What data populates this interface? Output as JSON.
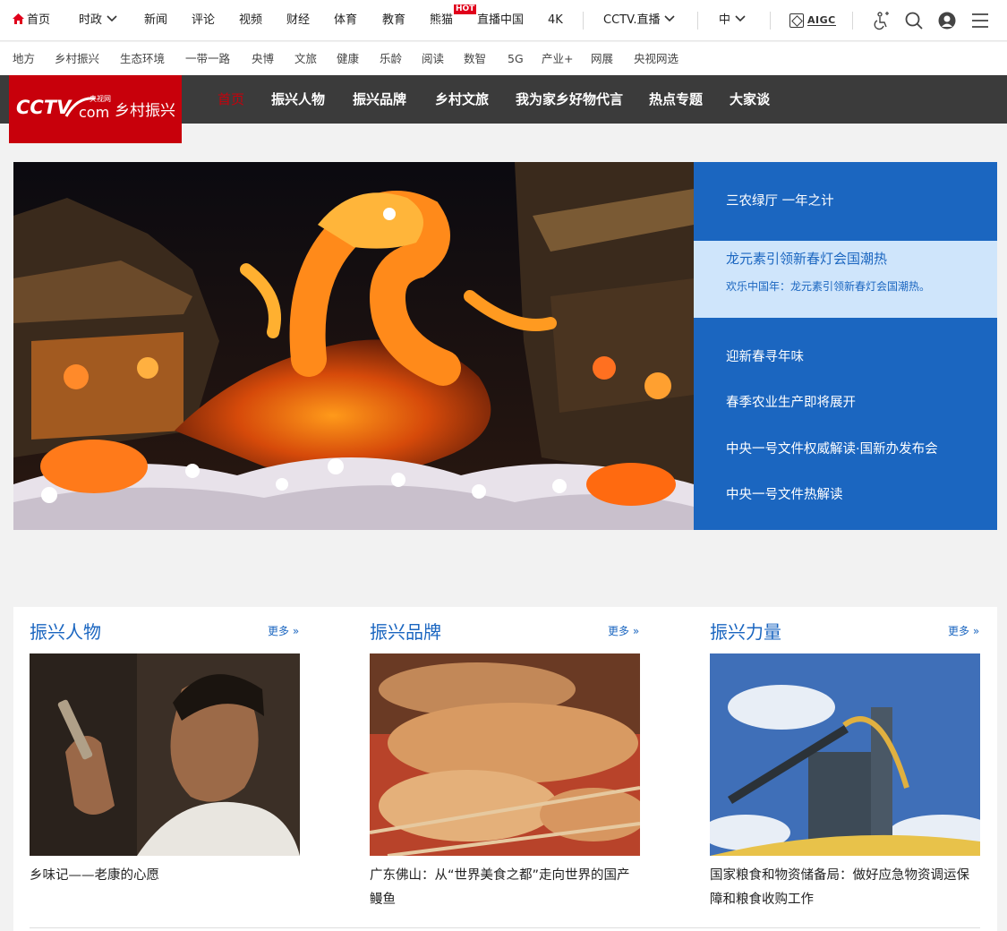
{
  "top_nav": {
    "home": "首页",
    "items": [
      "时政",
      "新闻",
      "评论",
      "视频",
      "财经",
      "体育",
      "教育",
      "熊猫",
      "直播中国",
      "4K"
    ],
    "hot_badge": "HOT",
    "live": "CCTV.直播",
    "lang": "中",
    "aigc": "AIGC"
  },
  "sub_nav": {
    "items": [
      "地方",
      "乡村振兴",
      "生态环境",
      "一带一路",
      "央博",
      "文旅",
      "健康",
      "乐龄",
      "阅读",
      "数智",
      "5G",
      "产业+",
      "网展",
      "央视网选"
    ]
  },
  "channel": {
    "logo_text": "乡村振兴",
    "tabs": [
      "首页",
      "振兴人物",
      "振兴品牌",
      "乡村文旅",
      "我为家乡好物代言",
      "热点专题",
      "大家谈"
    ]
  },
  "hero": {
    "items": [
      "三农绿厅 一年之计",
      "迎新春寻年味",
      "春季农业生产即将展开",
      "中央一号文件权威解读·国新办发布会",
      "中央一号文件热解读"
    ],
    "active_title": "龙元素引领新春灯会国潮热",
    "active_desc": "欢乐中国年：龙元素引领新春灯会国潮热。"
  },
  "columns": [
    {
      "title": "振兴人物",
      "more": "更多 »",
      "caption": "乡味记——老康的心愿"
    },
    {
      "title": "振兴品牌",
      "more": "更多 »",
      "caption": "广东佛山：从“世界美食之都”走向世界的国产鳗鱼"
    },
    {
      "title": "振兴力量",
      "more": "更多 »",
      "caption": "国家粮食和物资储备局：做好应急物资调运保障和粮食收购工作"
    }
  ],
  "colors": {
    "brand_red": "#c8000b",
    "blue": "#1b66c0",
    "light_blue": "#cfe5fb",
    "dark_bar": "#3b3b3b"
  }
}
